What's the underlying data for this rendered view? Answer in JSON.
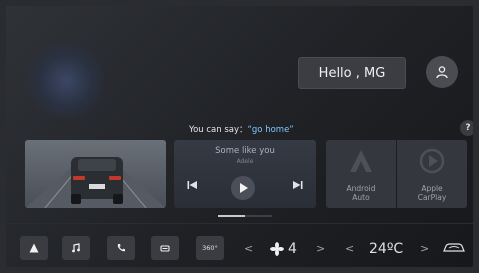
{
  "greeting": "Hello , MG",
  "voice": {
    "prefix": "You can say：",
    "command": "“go home”"
  },
  "help_label": "?",
  "media": {
    "song": "Some like you",
    "artist": "Adele"
  },
  "apps": {
    "android": "Android\nAuto",
    "carplay": "Apple\nCarPlay"
  },
  "dock": {
    "icons": [
      "navigation-icon",
      "music-icon",
      "phone-icon",
      "car-icon",
      "360-view-icon"
    ],
    "view360": "360°",
    "fan_speed": "4",
    "temperature": "24ºC"
  }
}
